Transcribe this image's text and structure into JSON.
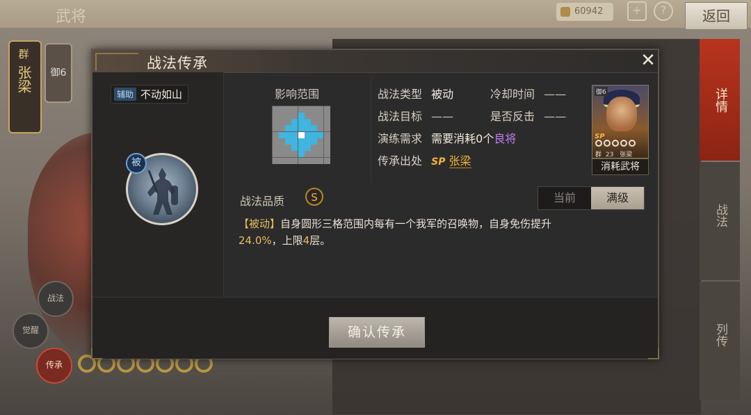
{
  "background": {
    "title": "武将",
    "coins": "60942",
    "plus_label": "+",
    "help_label": "?",
    "back_label": "返回",
    "hero_name": "张梁",
    "hero_badge": "群",
    "level_label": "御6",
    "tabs": [
      {
        "label": "详情"
      },
      {
        "label": "战法"
      },
      {
        "label": "列传"
      }
    ],
    "left_buttons": [
      {
        "label": "战法"
      },
      {
        "label": "觉醒"
      },
      {
        "label": "传承"
      }
    ]
  },
  "dialog": {
    "title": "战法传承",
    "close_label": "✕",
    "tactic": {
      "type_tag": "辅助",
      "name": "不动如山",
      "icon_badge": "被"
    },
    "range": {
      "title": "影响范围",
      "grid_size": 9,
      "center": [
        4,
        4
      ],
      "radius": 3
    },
    "info": {
      "type_label": "战法类型",
      "type_value": "被动",
      "cooldown_label": "冷却时间",
      "cooldown_value": "——",
      "target_label": "战法目标",
      "target_value": "——",
      "counter_label": "是否反击",
      "counter_value": "——",
      "requirement_label": "演练需求",
      "requirement_prefix": "需要消耗",
      "requirement_count": "0",
      "requirement_unit": "个",
      "requirement_rarity": "良将",
      "source_label": "传承出处",
      "source_sp": "SP",
      "source_name": "张梁"
    },
    "card": {
      "rank": "御6",
      "sp_label": "SP",
      "faction": "群",
      "level": "23",
      "name": "张梁",
      "caption": "消耗武将",
      "stars": 5
    },
    "quality": {
      "label": "战法品质",
      "grade": "S"
    },
    "toggle": {
      "current_label": "当前",
      "max_label": "满级",
      "selected": "满级"
    },
    "description": {
      "tag": "【被动】",
      "text_1": "自身圆形三格范围内每有一个我军的召唤物，自身免伤提升",
      "value": "24.0%",
      "text_2": "，上限",
      "limit": "4",
      "text_3": "层。"
    },
    "confirm_label": "确认传承"
  },
  "colors": {
    "range_cell": "#3fb5e0",
    "range_center": "#ffffff",
    "grid_base": "#8a8a8a",
    "highlight_gold": "#e8bd5c",
    "rarity_purple": "#c27ef0"
  }
}
